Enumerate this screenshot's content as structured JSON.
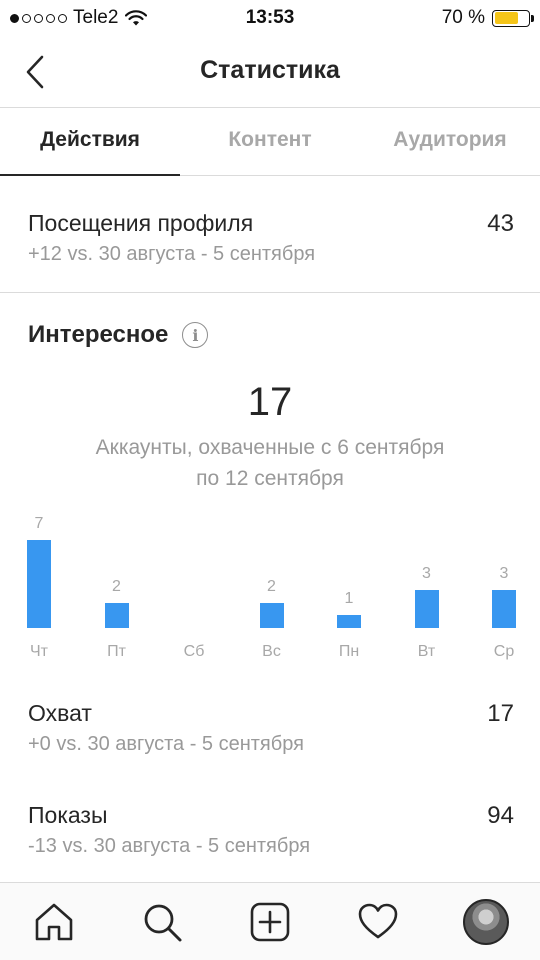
{
  "status_bar": {
    "carrier": "Tele2",
    "time": "13:53",
    "battery_percent": "70 %",
    "battery_level": 0.7,
    "signal_bars_filled": 1,
    "signal_bars_total": 5
  },
  "header": {
    "title": "Статистика",
    "back_icon": "chevron-left-icon"
  },
  "tabs": [
    {
      "label": "Действия",
      "active": true
    },
    {
      "label": "Контент",
      "active": false
    },
    {
      "label": "Аудитория",
      "active": false
    }
  ],
  "profile_visits": {
    "title": "Посещения профиля",
    "subtitle": "+12 vs. 30 августа - 5 сентября",
    "value": "43"
  },
  "discovery": {
    "title": "Интересное",
    "info_icon": "info-icon",
    "total": "17",
    "caption": "Аккаунты, охваченные с 6 сентября по 12 сентября"
  },
  "chart_data": {
    "type": "bar",
    "categories": [
      "Чт",
      "Пт",
      "Сб",
      "Вс",
      "Пн",
      "Вт",
      "Ср"
    ],
    "values": [
      7,
      2,
      0,
      2,
      1,
      3,
      3
    ],
    "value_labels": [
      "7",
      "2",
      "",
      "2",
      "1",
      "3",
      "3"
    ],
    "bar_color": "#3897f0",
    "ylim": [
      0,
      7
    ],
    "grid": false
  },
  "reach": {
    "title": "Охват",
    "subtitle": "+0 vs. 30 августа - 5 сентября",
    "value": "17"
  },
  "impressions": {
    "title": "Показы",
    "subtitle": "-13 vs. 30 августа - 5 сентября",
    "value": "94"
  },
  "tab_bar": {
    "items": [
      "home-icon",
      "search-icon",
      "add-post-icon",
      "heart-icon",
      "profile-avatar"
    ]
  },
  "colors": {
    "accent": "#3897f0",
    "text": "#262626",
    "secondary_text": "#999999",
    "battery": "#f5c518"
  }
}
